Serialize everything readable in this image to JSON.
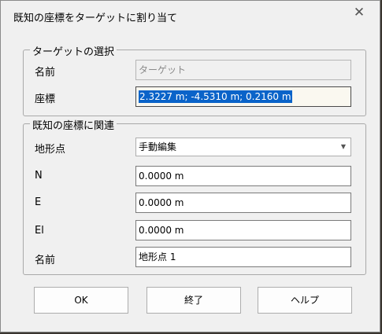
{
  "dialog": {
    "title": "既知の座標をターゲットに割り当て",
    "close_glyph": "✕"
  },
  "target_group": {
    "legend": "ターゲットの選択",
    "name_label": "名前",
    "name_value": "ターゲット",
    "coord_label": "座標",
    "coord_value": "2.3227 m; -4.5310 m; 0.2160 m"
  },
  "known_group": {
    "legend": "既知の座標に関連",
    "feature_label": "地形点",
    "feature_selected": "手動編集",
    "n_label": "N",
    "n_value": "0.0000 m",
    "e_label": "E",
    "e_value": "0.0000 m",
    "el_label": "El",
    "el_value": "0.0000 m",
    "name_label": "名前",
    "name_value": "地形点 1"
  },
  "buttons": {
    "ok": "OK",
    "finish": "終了",
    "help": "ヘルプ"
  }
}
